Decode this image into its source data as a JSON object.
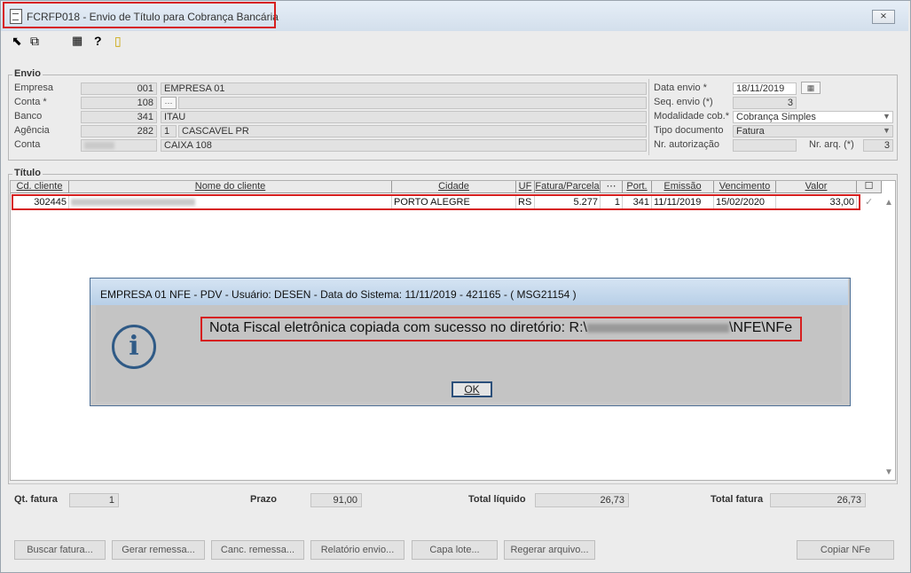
{
  "window": {
    "title": "FCRFP018 - Envio de Título para Cobrança Bancária",
    "close_symbol": "⨯"
  },
  "toolbar": {
    "icons": [
      "exit-icon",
      "copy-icon",
      "calendar-icon",
      "help-icon",
      "door-icon"
    ]
  },
  "envio": {
    "group_label": "Envio",
    "empresa": {
      "label": "Empresa",
      "code": "001",
      "name": "EMPRESA 01"
    },
    "conta_star": {
      "label": "Conta *",
      "code": "108"
    },
    "banco": {
      "label": "Banco",
      "code": "341",
      "name": "ITAU"
    },
    "agencia": {
      "label": "Agência",
      "code": "282",
      "digit": "1",
      "name": "CASCAVEL PR"
    },
    "conta": {
      "label": "Conta",
      "name": "CAIXA 108"
    },
    "data_envio": {
      "label": "Data envio *",
      "value": "18/11/2019"
    },
    "seq_envio": {
      "label": "Seq. envio (*)",
      "value": "3"
    },
    "modalidade": {
      "label": "Modalidade cob.*",
      "value": "Cobrança Simples"
    },
    "tipo_documento": {
      "label": "Tipo documento",
      "value": "Fatura"
    },
    "nr_autorizacao": {
      "label": "Nr. autorização",
      "value": ""
    },
    "nr_arq": {
      "label": "Nr. arq. (*)",
      "value": "3"
    }
  },
  "titulo": {
    "group_label": "Título",
    "columns": [
      "Cd. cliente",
      "Nome do cliente",
      "Cidade",
      "UF",
      "Fatura/Parcela",
      "Port.",
      "Emissão",
      "Vencimento",
      "Valor"
    ],
    "rows": [
      {
        "cd_cliente": "302445",
        "cidade": "PORTO ALEGRE",
        "uf": "RS",
        "fatura": "5.277",
        "parcela": "1",
        "port": "341",
        "emissao": "11/11/2019",
        "vencimento": "15/02/2020",
        "valor": "33,00",
        "checked": "✓"
      }
    ]
  },
  "dialog": {
    "title": "EMPRESA 01 NFE - PDV - Usuário: DESEN - Data do Sistema: 11/11/2019 - 421165 - ( MSG21154 )",
    "message_prefix": "Nota Fiscal eletrônica copiada com sucesso no diretório: R:\\",
    "message_suffix": "\\NFE\\NFe",
    "ok_label": "OK",
    "icon": "info-icon"
  },
  "summary": {
    "qt_fatura": {
      "label": "Qt. fatura",
      "value": "1"
    },
    "prazo": {
      "label": "Prazo",
      "value": "91,00"
    },
    "total_liquido": {
      "label": "Total líquido",
      "value": "26,73"
    },
    "total_fatura": {
      "label": "Total fatura",
      "value": "26,73"
    }
  },
  "buttons": {
    "buscar": "Buscar fatura...",
    "gerar": "Gerar remessa...",
    "canc": "Canc. remessa...",
    "relatorio": "Relatório envio...",
    "capa": "Capa lote...",
    "regerar": "Regerar arquivo...",
    "copiar": "Copiar NFe"
  },
  "colors": {
    "highlight": "#d61f1f",
    "dialog_border": "#4d6f95",
    "info_icon": "#2f5a86"
  }
}
